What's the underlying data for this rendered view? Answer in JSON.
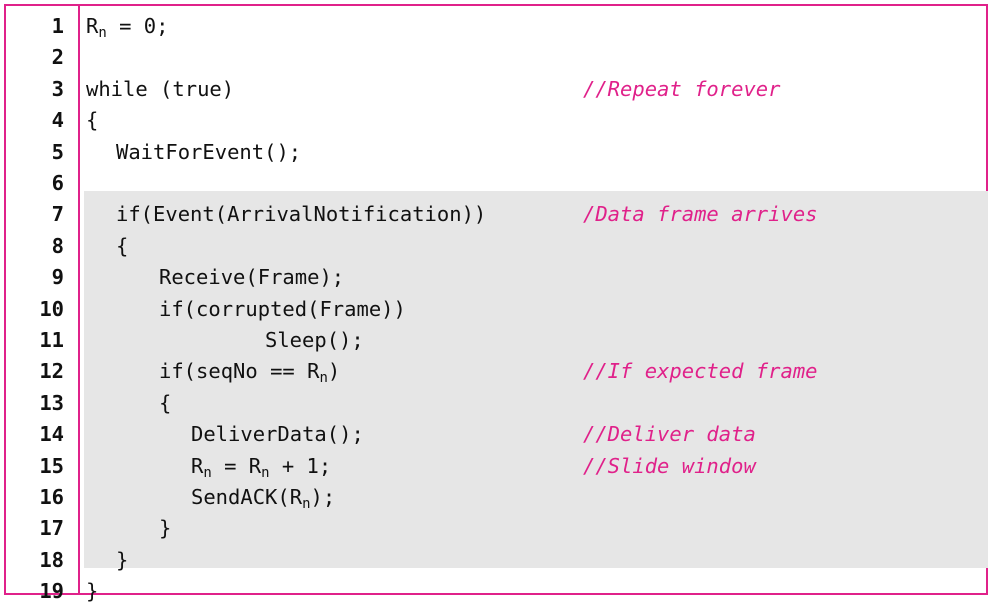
{
  "colors": {
    "frame": "#e0218a",
    "comment": "#e0218a",
    "shade": "#e6e6e6",
    "text": "#111111"
  },
  "lines": [
    {
      "num": "1",
      "indent": 0,
      "parts": [
        {
          "t": "R"
        },
        {
          "s": "n"
        },
        {
          "t": " = 0;"
        }
      ],
      "comment": ""
    },
    {
      "num": "2",
      "indent": 0,
      "parts": [],
      "comment": ""
    },
    {
      "num": "3",
      "indent": 0,
      "parts": [
        {
          "t": "while (true)"
        }
      ],
      "comment": "//Repeat forever"
    },
    {
      "num": "4",
      "indent": 0,
      "parts": [
        {
          "t": "{"
        }
      ],
      "comment": ""
    },
    {
      "num": "5",
      "indent": 1,
      "parts": [
        {
          "t": "WaitForEvent();"
        }
      ],
      "comment": ""
    },
    {
      "num": "6",
      "indent": 0,
      "parts": [],
      "comment": ""
    },
    {
      "num": "7",
      "indent": 1,
      "parts": [
        {
          "t": "if(Event(ArrivalNotification))"
        }
      ],
      "comment": "/Data frame arrives"
    },
    {
      "num": "8",
      "indent": 1,
      "parts": [
        {
          "t": "{"
        }
      ],
      "comment": ""
    },
    {
      "num": "9",
      "indent": 2,
      "parts": [
        {
          "t": "Receive(Frame);"
        }
      ],
      "comment": ""
    },
    {
      "num": "10",
      "indent": 2,
      "parts": [
        {
          "t": "if(corrupted(Frame))"
        }
      ],
      "comment": ""
    },
    {
      "num": "11",
      "indent": 4,
      "parts": [
        {
          "t": "Sleep();"
        }
      ],
      "comment": ""
    },
    {
      "num": "12",
      "indent": 2,
      "parts": [
        {
          "t": "if(seqNo == R"
        },
        {
          "s": "n"
        },
        {
          "t": ")"
        }
      ],
      "comment": "//If expected frame"
    },
    {
      "num": "13",
      "indent": 2,
      "parts": [
        {
          "t": "{"
        }
      ],
      "comment": ""
    },
    {
      "num": "14",
      "indent": 3,
      "parts": [
        {
          "t": "DeliverData();"
        }
      ],
      "comment": "//Deliver data"
    },
    {
      "num": "15",
      "indent": 3,
      "parts": [
        {
          "t": "R"
        },
        {
          "s": "n"
        },
        {
          "t": " = R"
        },
        {
          "s": "n"
        },
        {
          "t": " + 1;"
        }
      ],
      "comment": "//Slide window"
    },
    {
      "num": "16",
      "indent": 3,
      "parts": [
        {
          "t": "SendACK(R"
        },
        {
          "s": "n"
        },
        {
          "t": ");"
        }
      ],
      "comment": ""
    },
    {
      "num": "17",
      "indent": 2,
      "parts": [
        {
          "t": "}"
        }
      ],
      "comment": ""
    },
    {
      "num": "18",
      "indent": 1,
      "parts": [
        {
          "t": "}"
        }
      ],
      "comment": ""
    },
    {
      "num": "19",
      "indent": 0,
      "parts": [
        {
          "t": "}"
        }
      ],
      "comment": ""
    }
  ]
}
